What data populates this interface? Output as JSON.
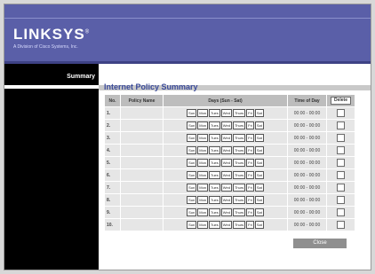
{
  "brand": {
    "logo_text": "LINKSYS",
    "tagline": "A Division of Cisco Systems, Inc."
  },
  "sidebar": {
    "active_tab": "Summary"
  },
  "page": {
    "title": "Internet Policy Summary",
    "close_label": "Close"
  },
  "table": {
    "headers": {
      "no": "No.",
      "policy_name": "Policy Name",
      "days": "Days (Sun - Sat)",
      "time_of_day": "Time of Day",
      "delete": "Delete"
    },
    "day_labels": [
      "Sun",
      "Mon",
      "Tues",
      "Wed",
      "Thurs",
      "Fri",
      "Sat"
    ],
    "rows": [
      {
        "no": "1.",
        "name": "",
        "time": "00:00 - 00:00"
      },
      {
        "no": "2.",
        "name": "",
        "time": "00:00 - 00:00"
      },
      {
        "no": "3.",
        "name": "",
        "time": "00:00 - 00:00"
      },
      {
        "no": "4.",
        "name": "",
        "time": "00:00 - 00:00"
      },
      {
        "no": "5.",
        "name": "",
        "time": "00:00 - 00:00"
      },
      {
        "no": "6.",
        "name": "",
        "time": "00:00 - 00:00"
      },
      {
        "no": "7.",
        "name": "",
        "time": "00:00 - 00:00"
      },
      {
        "no": "8.",
        "name": "",
        "time": "00:00 - 00:00"
      },
      {
        "no": "9.",
        "name": "",
        "time": "00:00 - 00:00"
      },
      {
        "no": "10.",
        "name": "",
        "time": "00:00 - 00:00"
      }
    ]
  },
  "colors": {
    "header": "#5a5fa8",
    "title": "#3a4a9a"
  }
}
